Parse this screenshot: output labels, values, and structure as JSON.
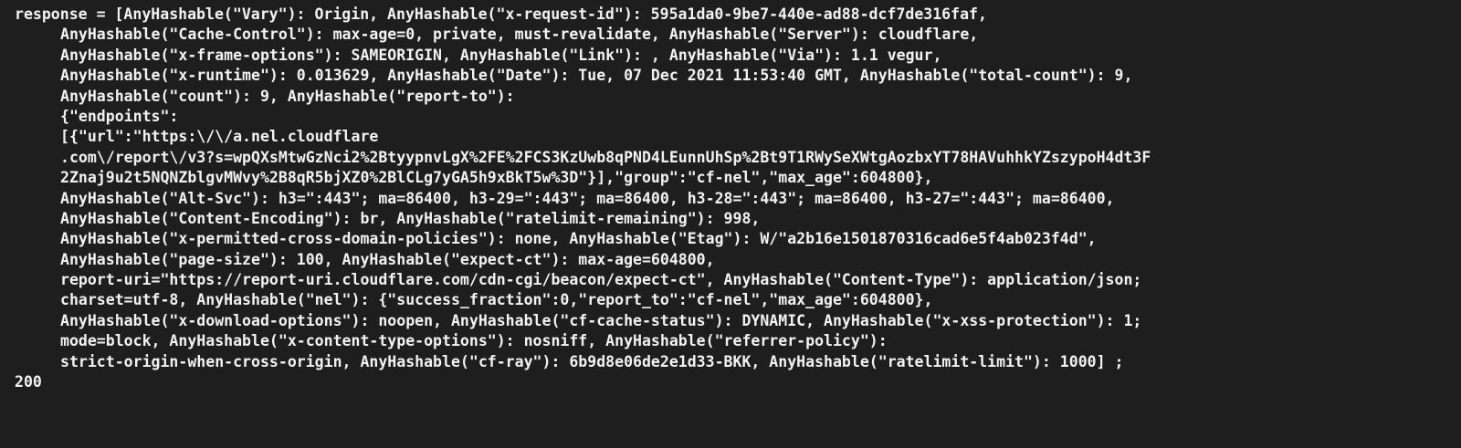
{
  "console": {
    "lines": [
      {
        "text": "response = [AnyHashable(\"Vary\"): Origin, AnyHashable(\"x-request-id\"): 595a1da0-9be7-440e-ad88-dcf7de316faf,"
      },
      {
        "text": "AnyHashable(\"Cache-Control\"): max-age=0, private, must-revalidate, AnyHashable(\"Server\"): cloudflare,"
      },
      {
        "text": "AnyHashable(\"x-frame-options\"): SAMEORIGIN, AnyHashable(\"Link\"): , AnyHashable(\"Via\"): 1.1 vegur,"
      },
      {
        "text": "AnyHashable(\"x-runtime\"): 0.013629, AnyHashable(\"Date\"): Tue, 07 Dec 2021 11:53:40 GMT, AnyHashable(\"total-count\"): 9,"
      },
      {
        "text": "AnyHashable(\"count\"): 9, AnyHashable(\"report-to\"):"
      },
      {
        "text": "{\"endpoints\":"
      },
      {
        "text": "[{\"url\":\"https:\\/\\/a.nel.cloudflare"
      },
      {
        "text": ".com\\/report\\/v3?s=wpQXsMtwGzNci2%2BtyypnvLgX%2FE%2FCS3KzUwb8qPND4LEunnUhSp%2Bt9T1RWySeXWtgAozbxYT78HAVuhhkYZszypoH4dt3F"
      },
      {
        "text": "2Znaj9u2t5NQNZblgvMWvy%2B8qR5bjXZ0%2BlCLg7yGA5h9xBkT5w%3D\"}],\"group\":\"cf-nel\",\"max_age\":604800},"
      },
      {
        "text": "AnyHashable(\"Alt-Svc\"): h3=\":443\"; ma=86400, h3-29=\":443\"; ma=86400, h3-28=\":443\"; ma=86400, h3-27=\":443\"; ma=86400,"
      },
      {
        "text": "AnyHashable(\"Content-Encoding\"): br, AnyHashable(\"ratelimit-remaining\"): 998,"
      },
      {
        "text": "AnyHashable(\"x-permitted-cross-domain-policies\"): none, AnyHashable(\"Etag\"): W/\"a2b16e1501870316cad6e5f4ab023f4d\","
      },
      {
        "text": "AnyHashable(\"page-size\"): 100, AnyHashable(\"expect-ct\"): max-age=604800,"
      },
      {
        "text": "report-uri=\"https://report-uri.cloudflare.com/cdn-cgi/beacon/expect-ct\", AnyHashable(\"Content-Type\"): application/json;"
      },
      {
        "text": "charset=utf-8, AnyHashable(\"nel\"): {\"success_fraction\":0,\"report_to\":\"cf-nel\",\"max_age\":604800},"
      },
      {
        "text": "AnyHashable(\"x-download-options\"): noopen, AnyHashable(\"cf-cache-status\"): DYNAMIC, AnyHashable(\"x-xss-protection\"): 1;"
      },
      {
        "text": "mode=block, AnyHashable(\"x-content-type-options\"): nosniff, AnyHashable(\"referrer-policy\"):"
      },
      {
        "text": "strict-origin-when-cross-origin, AnyHashable(\"cf-ray\"): 6b9d8e06de2e1d33-BKK, AnyHashable(\"ratelimit-limit\"): 1000] ;"
      },
      {
        "text": "200"
      }
    ]
  }
}
